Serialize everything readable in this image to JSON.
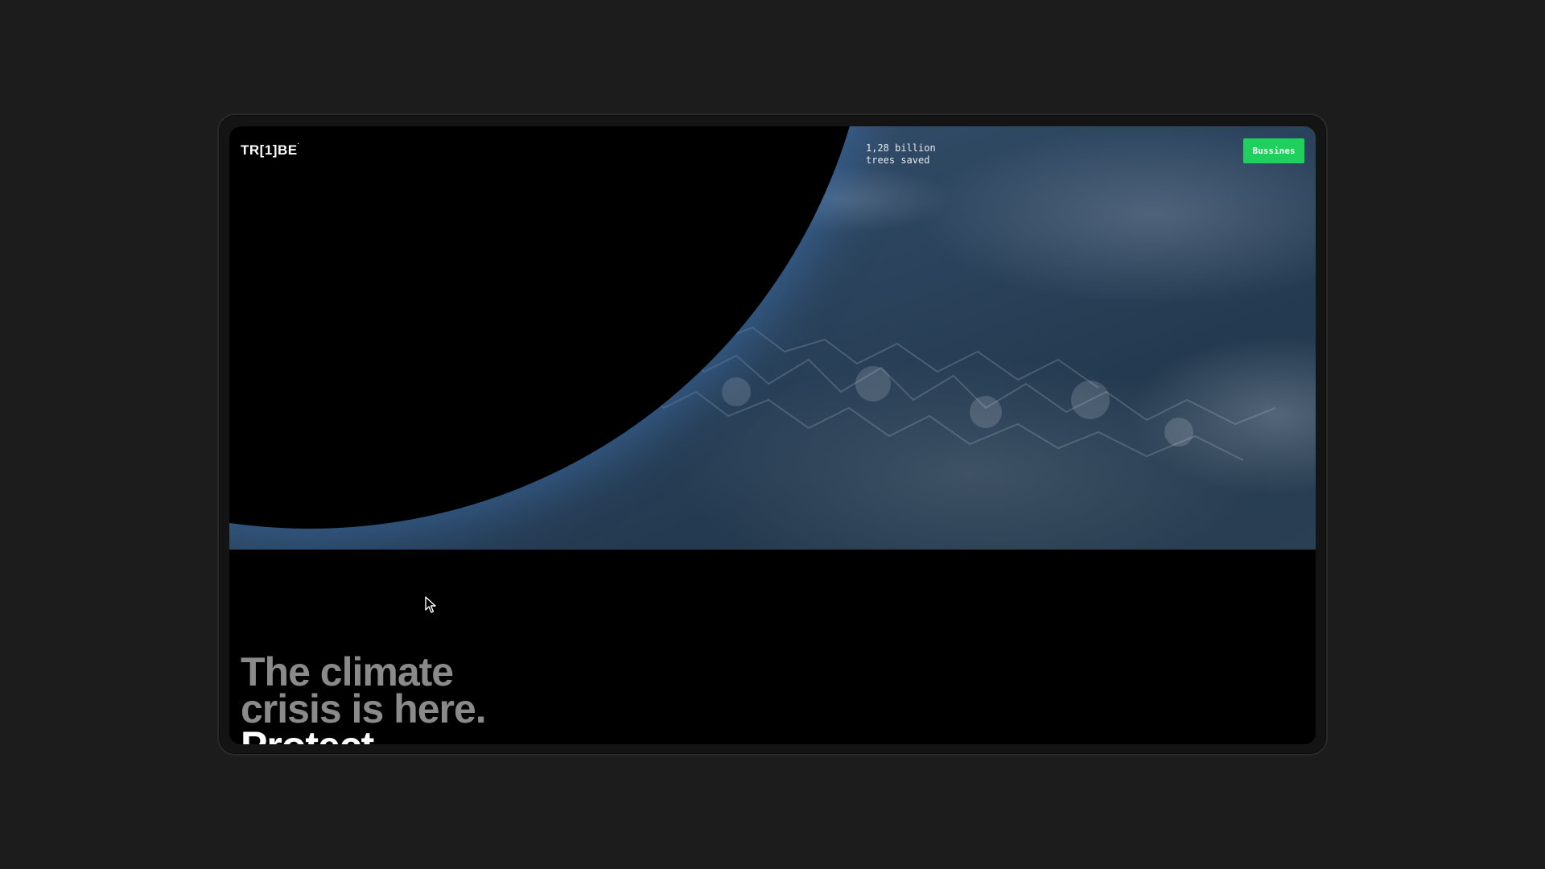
{
  "header": {
    "logo_text": "TR[1]BE",
    "logo_mark": "·",
    "stat_line1": "1,28 billion",
    "stat_line2": "trees saved",
    "business_button": "Bussines"
  },
  "headline": {
    "line1": "The climate",
    "line2": "crisis is here.",
    "line3": "Protect"
  },
  "colors": {
    "accent_green": "#1fd05f",
    "page_background": "#1c1c1d",
    "screen_background": "#000000",
    "headline_muted": "#8a8a8a"
  },
  "icons": {
    "cursor": "mouse-pointer-icon"
  }
}
